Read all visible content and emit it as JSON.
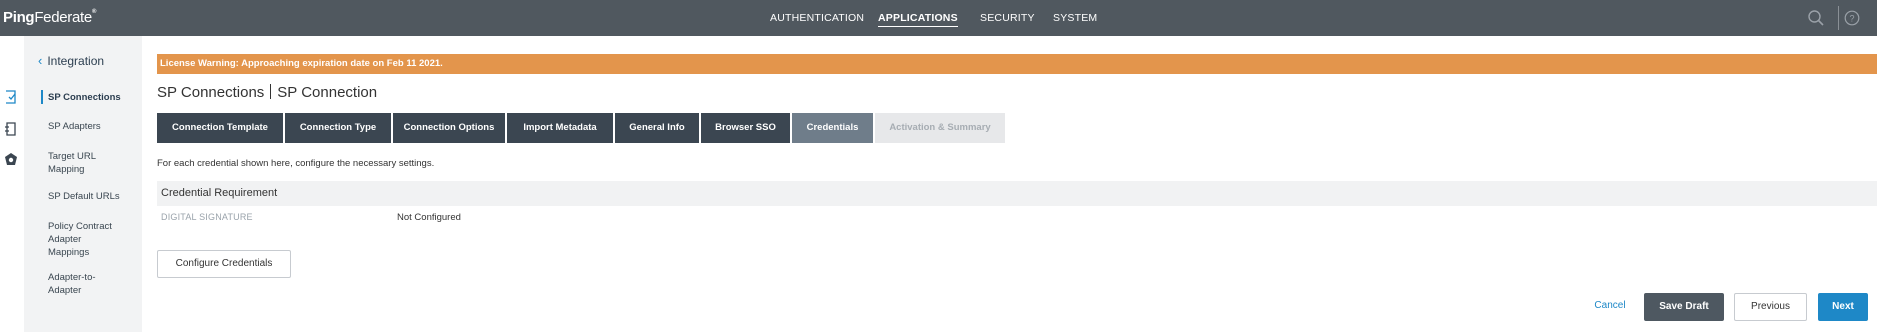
{
  "header": {
    "logo_bold": "Ping",
    "logo_light": "Federate",
    "nav": [
      {
        "label": "AUTHENTICATION",
        "active": false
      },
      {
        "label": "APPLICATIONS",
        "active": true
      },
      {
        "label": "SECURITY",
        "active": false
      },
      {
        "label": "SYSTEM",
        "active": false
      }
    ],
    "icons": [
      "search-icon",
      "help-icon"
    ]
  },
  "rail": {
    "icons": [
      "sp-connections-icon",
      "sp-adapters-icon",
      "target-mapping-icon"
    ]
  },
  "subnav": {
    "back_label": "Integration",
    "items": [
      {
        "label": "SP Connections",
        "active": true
      },
      {
        "label": "SP Adapters",
        "active": false
      },
      {
        "label": "Target URL Mapping",
        "active": false
      },
      {
        "label": "SP Default URLs",
        "active": false
      },
      {
        "label": "Policy Contract Adapter Mappings",
        "active": false
      },
      {
        "label": "Adapter-to-Adapter",
        "active": false
      }
    ]
  },
  "license_warning": "License Warning: Approaching expiration date on Feb 11 2021.",
  "breadcrumb": {
    "first": "SP Connections",
    "second": "SP Connection"
  },
  "tabs": [
    {
      "label": "Connection Template",
      "state": "done"
    },
    {
      "label": "Connection Type",
      "state": "done"
    },
    {
      "label": "Connection Options",
      "state": "done"
    },
    {
      "label": "Import Metadata",
      "state": "done"
    },
    {
      "label": "General Info",
      "state": "done"
    },
    {
      "label": "Browser SSO",
      "state": "done"
    },
    {
      "label": "Credentials",
      "state": "current"
    },
    {
      "label": "Activation & Summary",
      "state": "disabled"
    }
  ],
  "content": {
    "instructions": "For each credential shown here, configure the necessary settings.",
    "section_title": "Credential Requirement",
    "row_label": "DIGITAL SIGNATURE",
    "row_value": "Not Configured",
    "configure_button": "Configure Credentials"
  },
  "footer": {
    "cancel": "Cancel",
    "save_draft": "Save Draft",
    "previous": "Previous",
    "next": "Next"
  },
  "colors": {
    "topbar": "#50585f",
    "accent": "#1e88c7",
    "warning": "#e3954c",
    "tab_done": "#3b4651",
    "tab_current": "#6f7d8a"
  }
}
